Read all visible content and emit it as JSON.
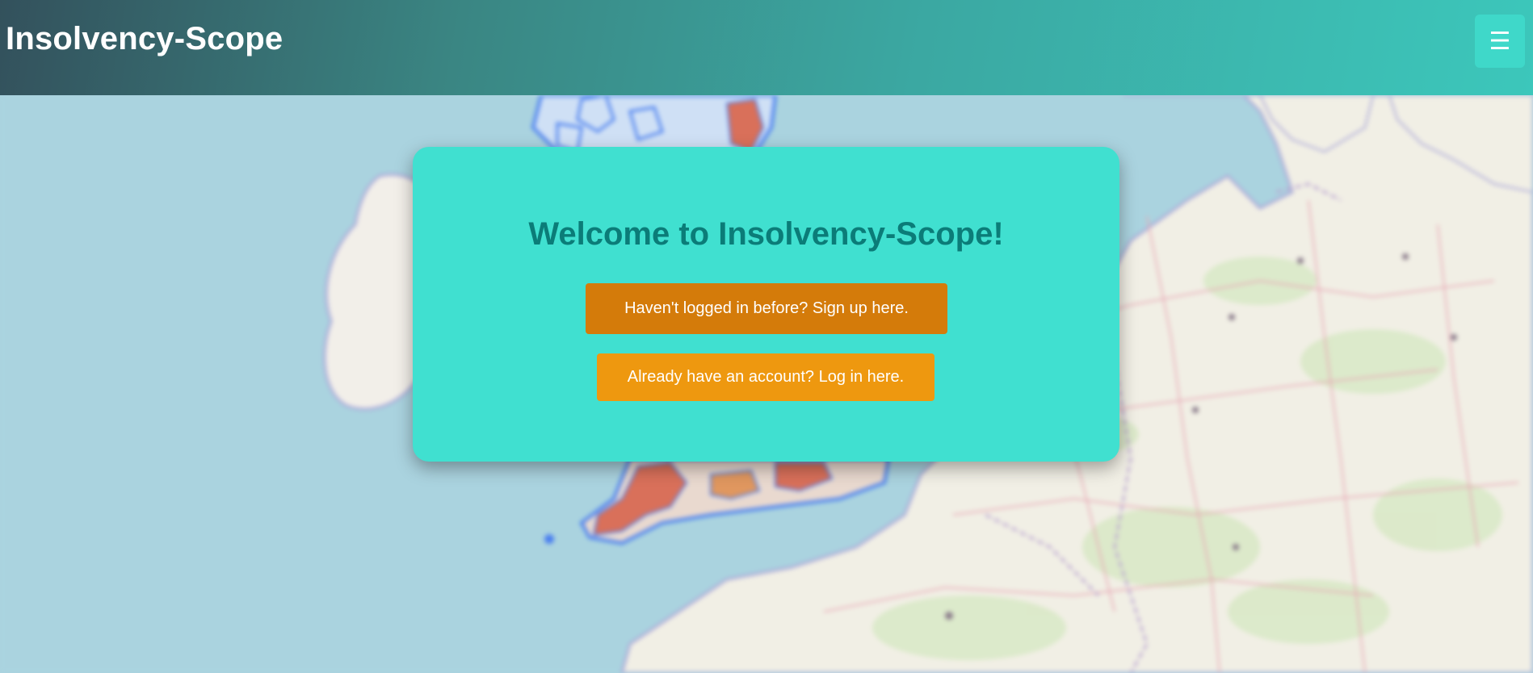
{
  "header": {
    "app_title": "Insolvency-Scope",
    "menu_icon": "☰"
  },
  "card": {
    "title": "Welcome to Insolvency-Scope!",
    "signup_label": "Haven't logged in before? Sign up here.",
    "login_label": "Already have an account? Log in here."
  },
  "colors": {
    "accent": "#40e0d0",
    "title_text": "#0b7c78",
    "signup_button": "#d47b0a",
    "login_button": "#ee980f"
  }
}
